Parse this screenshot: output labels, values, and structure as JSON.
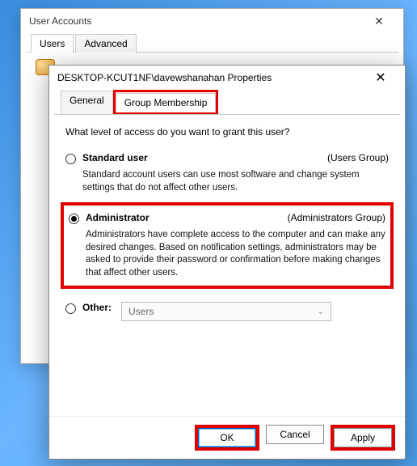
{
  "parent": {
    "title": "User Accounts",
    "tabs": {
      "users": "Users",
      "advanced": "Advanced"
    }
  },
  "dialog": {
    "title": "DESKTOP-KCUT1NF\\davewshanahan Properties",
    "tabs": {
      "general": "General",
      "group": "Group Membership"
    },
    "prompt": "What level of access do you want to grant this user?",
    "options": {
      "standard": {
        "label": "Standard user",
        "group": "(Users Group)",
        "desc": "Standard account users can use most software and change system settings that do not affect other users."
      },
      "admin": {
        "label": "Administrator",
        "group": "(Administrators Group)",
        "desc": "Administrators have complete access to the computer and can make any desired changes. Based on notification settings, administrators may be asked to provide their password or confirmation before making changes that affect other users."
      },
      "other": {
        "label": "Other:",
        "select_value": "Users"
      }
    },
    "buttons": {
      "ok": "OK",
      "cancel": "Cancel",
      "apply": "Apply"
    }
  }
}
